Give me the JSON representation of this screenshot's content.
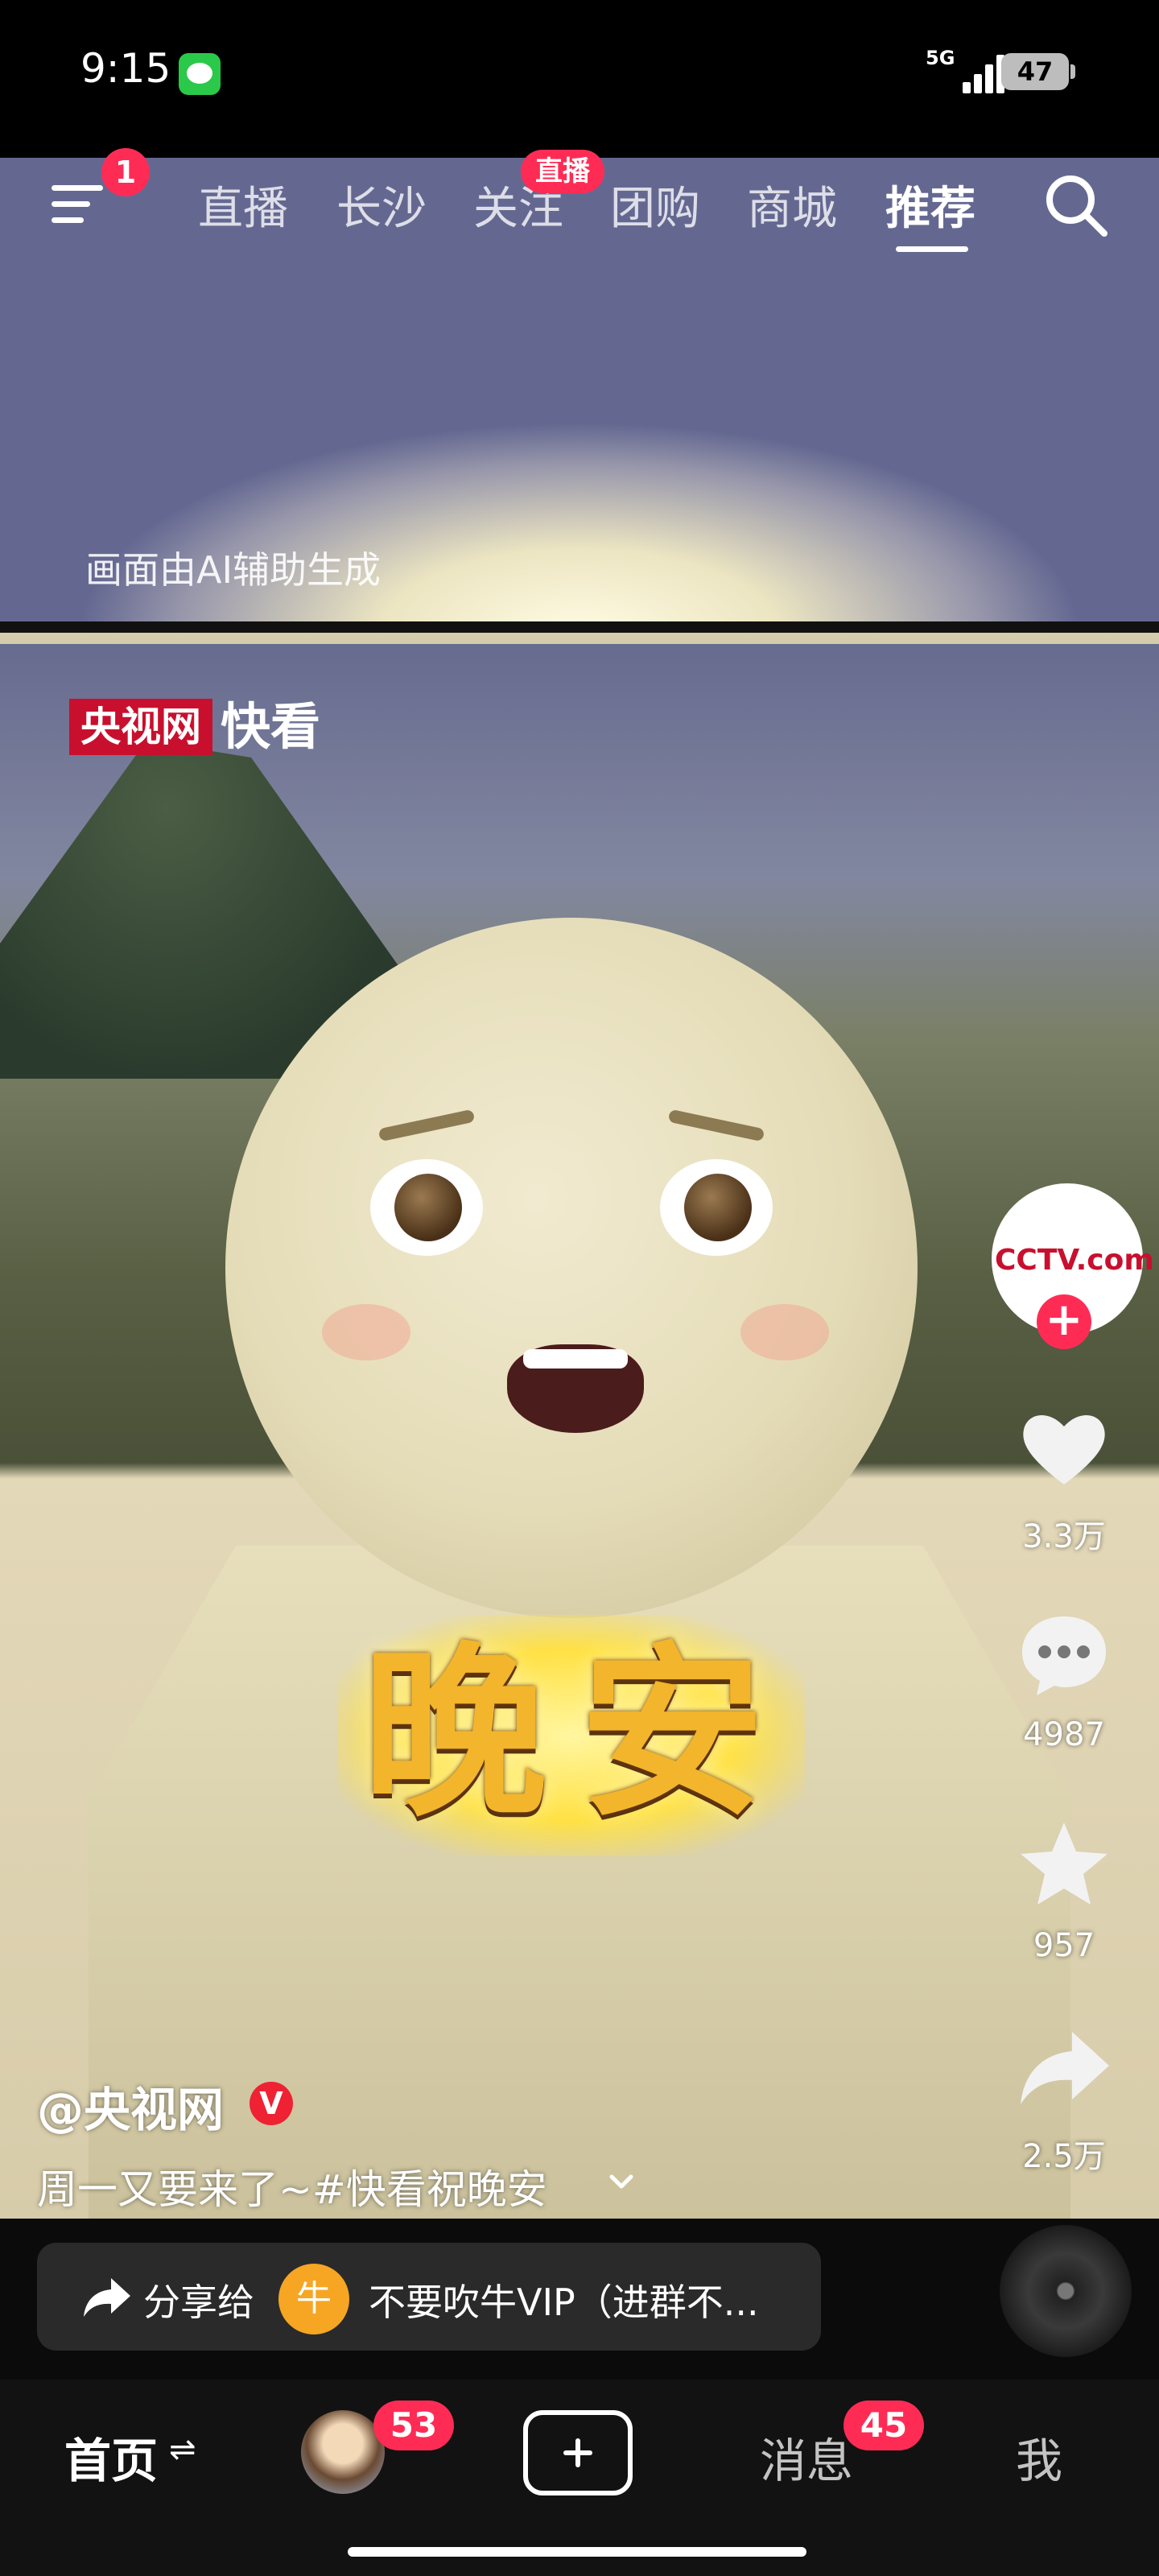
{
  "status_bar": {
    "time": "9:15",
    "network": "5G",
    "battery": "47"
  },
  "top_nav": {
    "menu_badge": "1",
    "tabs": [
      {
        "label": "直播",
        "active": false
      },
      {
        "label": "长沙",
        "active": false
      },
      {
        "label": "关注",
        "active": false,
        "badge": "直播"
      },
      {
        "label": "团购",
        "active": false
      },
      {
        "label": "商城",
        "active": false
      },
      {
        "label": "推荐",
        "active": true
      }
    ]
  },
  "video": {
    "ai_note": "画面由AI辅助生成",
    "watermark": {
      "brand": "央视网",
      "label": "快看"
    },
    "caption": "晚安"
  },
  "actions": {
    "avatar_text": "CCTV.com",
    "follow": "+",
    "likes": "3.3万",
    "comments": "4987",
    "favorites": "957",
    "shares": "2.5万"
  },
  "post": {
    "author": "@央视网",
    "verified": "V",
    "description": "周一又要来了~#快看祝晚安"
  },
  "share_bar": {
    "label": "分享给",
    "group_avatar": "牛",
    "group_name": "不要吹牛VIP（进群不..."
  },
  "bottom_nav": {
    "home": "首页",
    "friends_badge": "53",
    "messages": "消息",
    "messages_badge": "45",
    "me": "我"
  }
}
